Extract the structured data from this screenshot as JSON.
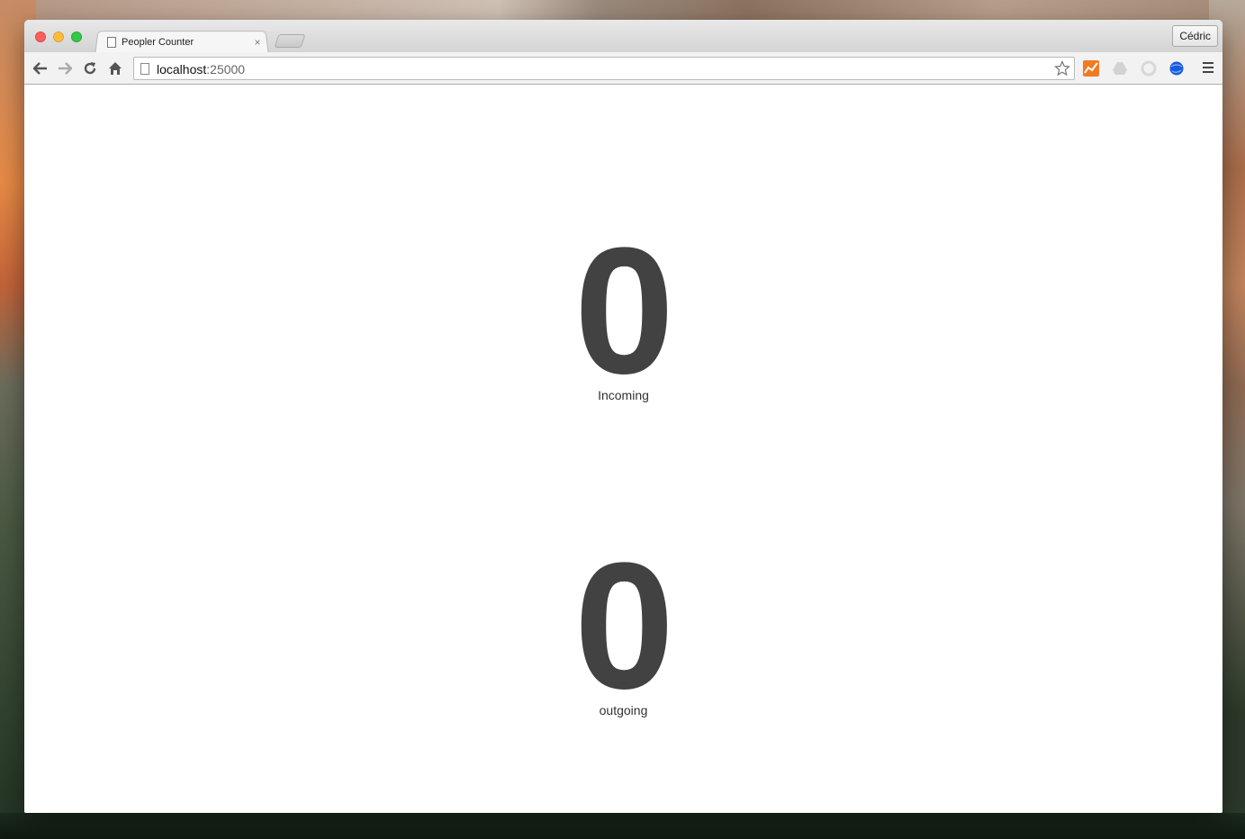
{
  "browser": {
    "tab": {
      "title": "Peopler Counter",
      "close_label": "×"
    },
    "profile": {
      "name": "Cédric"
    },
    "address": {
      "host": "localhost",
      "port": ":25000"
    }
  },
  "counters": {
    "incoming": {
      "value": "0",
      "label": "Incoming"
    },
    "outgoing": {
      "value": "0",
      "label": "outgoing"
    }
  },
  "colors": {
    "counter_text": "#424242",
    "extension_orange": "#f07b22",
    "extension_blue": "#1a5ae0"
  }
}
